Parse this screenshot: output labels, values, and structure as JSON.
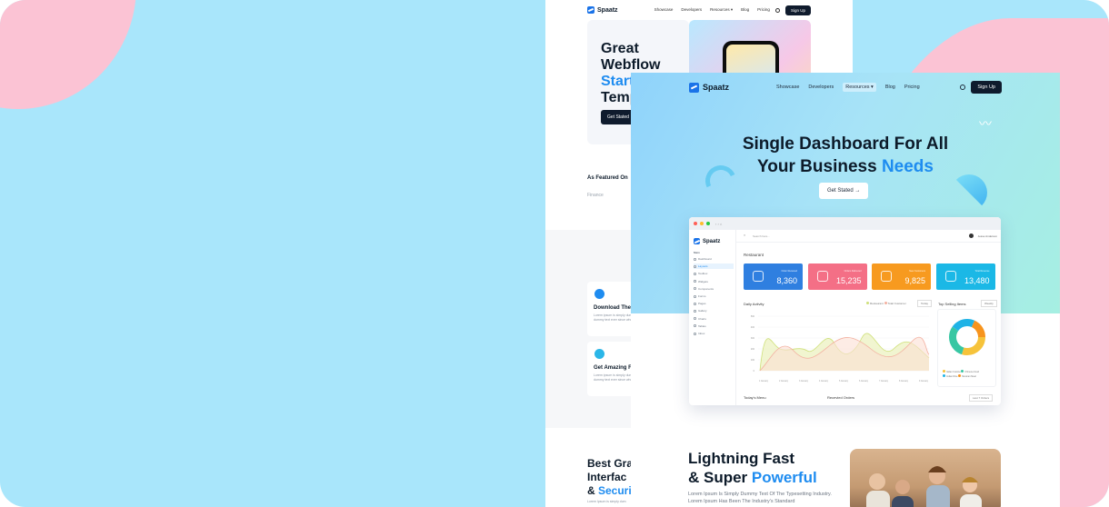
{
  "back_page": {
    "nav": {
      "brand": "Spaatz",
      "links": [
        "Showcase",
        "Developers",
        "Resources ▾",
        "Blog",
        "Pricing"
      ],
      "signup": "Sign Up"
    },
    "hero": {
      "line1": "Great",
      "line2": "Webflow",
      "line3": "Start",
      "line4": "Temp",
      "button": "Get Stated →"
    },
    "featured": {
      "title": "As Featured On",
      "logo": "Finance"
    },
    "features": [
      {
        "title": "Download The A",
        "text": "Lorem ipsum is simply dummy text of the printing Lorem Ipsum has been the industry's standard dummy text ever since when unknown printer"
      },
      {
        "title": "Get Amazing Fe",
        "text": "Lorem ipsum is simply dummy text of the printing Lorem Ipsum has been the industry's standard dummy text ever since when unknown printer"
      }
    ],
    "best": {
      "line1": "Best Gra",
      "line2": "Interfac",
      "line3_prefix": "& ",
      "line3_blue": "Securi",
      "sub": "Lorem Ipsum is simply dum"
    }
  },
  "front": {
    "nav": {
      "brand": "Spaatz",
      "links": [
        "Showcase",
        "Developers",
        "Resources ▾",
        "Blog",
        "Pricing"
      ],
      "active_index": 2,
      "signup": "Sign Up"
    },
    "headline_line1": "Single Dashboard For All",
    "headline_line2_prefix": "Your Business ",
    "headline_line2_blue": "Needs",
    "cta": "Get Stated →"
  },
  "dashboard": {
    "brand": "Spaatz",
    "search": "Search here...",
    "user": "Jesse Anderson",
    "sidebar_heading": "Main",
    "sidebar": [
      "Dashboard",
      "Layouts",
      "Toolbox",
      "Widgets",
      "Components",
      "Forms",
      "Pages",
      "Gallery",
      "Charts",
      "Tables",
      "Inbox"
    ],
    "sidebar_active": 1,
    "section": "Restaurant",
    "stats": [
      {
        "label": "Order Received",
        "value": "8,360",
        "color": "#2f7fe0"
      },
      {
        "label": "Orders Delivered",
        "value": "15,235",
        "color": "#f46f86"
      },
      {
        "label": "New Customers",
        "value": "9,825",
        "color": "#f79a1f"
      },
      {
        "label": "Total Revenue",
        "value": "13,480",
        "color": "#1bb8e6"
      }
    ],
    "activity_title": "Daily Activity",
    "activity_legend": [
      "Restaurant",
      "Total Customer"
    ],
    "activity_filter": "Today",
    "top_selling_title": "Top Selling Items",
    "top_selling_filter": "Weekly",
    "bottom_left": "Today's Menu",
    "bottom_right": "Recevied Orders",
    "bottom_button": "Last 7 Orders",
    "donut_legend": [
      "Italian Cuisine",
      "Chinese Food",
      "Indian Rice",
      "Mexican Meal"
    ],
    "chart_ticks_y": [
      "500",
      "400",
      "300",
      "200",
      "100",
      "0"
    ],
    "chart_ticks_x": [
      "1 January",
      "2 January",
      "3 January",
      "4 January",
      "5 January",
      "6 January",
      "7 January",
      "8 January",
      "9 January"
    ]
  },
  "lightning": {
    "line1": "Lightning Fast",
    "line2_prefix": "& Super ",
    "line2_blue": "Powerful",
    "sub": "Lorem Ipsum Is Simply Dummy Text Of The Typesetting Industry. Lorem Ipsum Has Been The Industry's Standard"
  },
  "colors": {
    "brand_blue": "#1e8cf0",
    "navy": "#0f1b2d",
    "bg_blue": "#a9e6fb",
    "bg_pink": "#fbc3d4"
  }
}
